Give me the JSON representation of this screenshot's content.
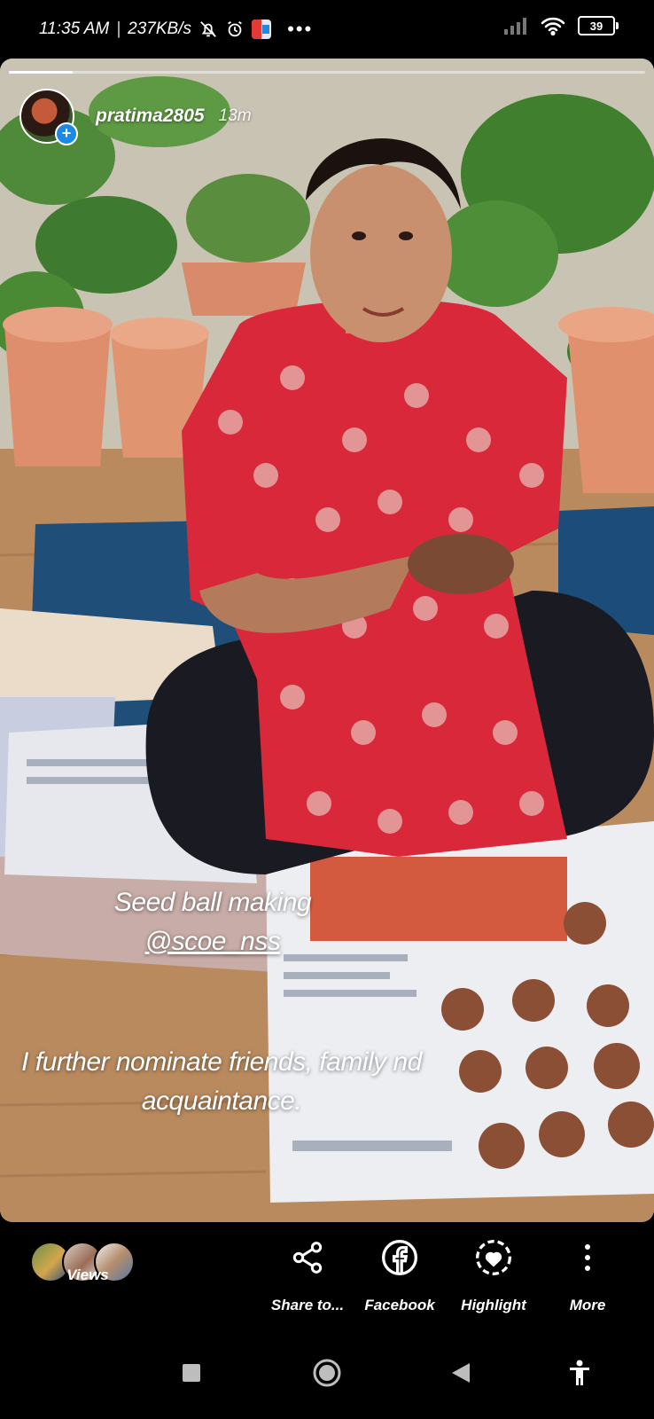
{
  "status_bar": {
    "time": "11:35 AM",
    "speed": "237KB/s",
    "more_dots": "•••",
    "battery": "39",
    "icons": [
      "notifications-off-icon",
      "alarm-icon",
      "app-notification-icon",
      "signal-icon",
      "wifi-icon",
      "battery-icon"
    ]
  },
  "story": {
    "username": "pratima2805",
    "time_ago": "13m",
    "progress": 0.1,
    "caption_line1": "Seed ball making",
    "caption_mention": "@scoe_nss",
    "caption_line2": "I further nominate friends, family nd",
    "caption_line3": "acquaintance."
  },
  "actions": {
    "views": "Views",
    "share": "Share to...",
    "facebook": "Facebook",
    "highlight": "Highlight",
    "more": "More"
  },
  "nav": {
    "icons": [
      "recent-apps-icon",
      "home-icon",
      "back-icon",
      "accessibility-icon"
    ]
  }
}
